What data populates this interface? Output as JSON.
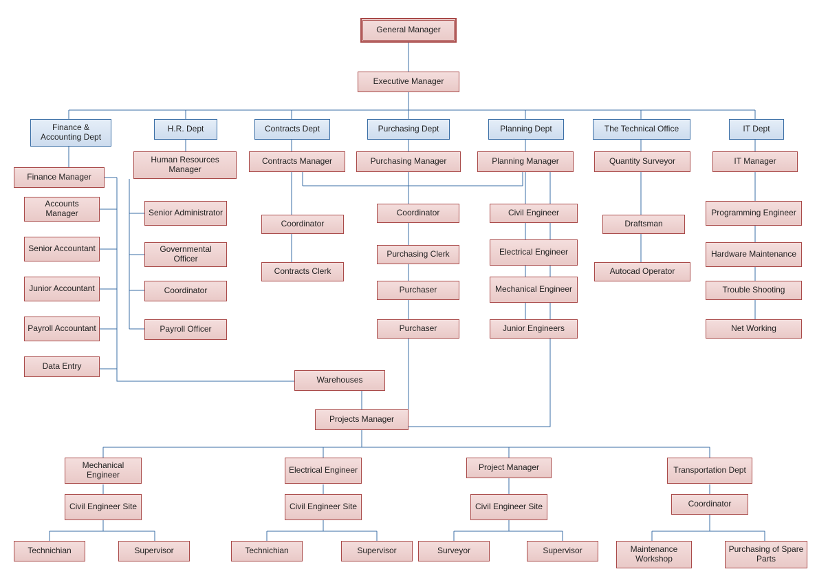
{
  "top": {
    "gm": "General Manager",
    "em": "Executive Manager"
  },
  "depts": {
    "finance": "Finance & Accounting Dept",
    "hr": "H.R. Dept",
    "contracts": "Contracts Dept",
    "purchasing": "Purchasing Dept",
    "planning": "Planning Dept",
    "technical": "The Technical Office",
    "it": "IT Dept"
  },
  "mgr": {
    "finance": "Finance Manager",
    "hr": "Human Resources Manager",
    "contracts": "Contracts Manager",
    "purchasing": "Purchasing Manager",
    "planning": "Planning Manager",
    "technical": "Quantity Surveyor",
    "it": "IT Manager"
  },
  "finance_sub": {
    "accounts_manager": "Accounts Manager",
    "senior_accountant": "Senior Accountant",
    "junior_accountant": "Junior Accountant",
    "payroll_accountant": "Payroll Accountant",
    "data_entry": "Data Entry"
  },
  "hr_sub": {
    "senior_admin": "Senior Administrator",
    "gov_officer": "Governmental Officer",
    "coordinator": "Coordinator",
    "payroll_officer": "Payroll Officer"
  },
  "contracts_sub": {
    "coordinator": "Coordinator",
    "clerk": "Contracts Clerk"
  },
  "purchasing_sub": {
    "coordinator": "Coordinator",
    "clerk": "Purchasing Clerk",
    "purchaser1": "Purchaser",
    "purchaser2": "Purchaser"
  },
  "planning_sub": {
    "civil": "Civil Engineer",
    "electrical": "Electrical Engineer",
    "mechanical": "Mechanical Engineer",
    "junior": "Junior Engineers"
  },
  "technical_sub": {
    "draftsman": "Draftsman",
    "autocad": "Autocad Operator"
  },
  "it_sub": {
    "programming": "Programming Engineer",
    "hardware": "Hardware Maintenance",
    "trouble": "Trouble Shooting",
    "networking": "Net Working"
  },
  "mid": {
    "warehouses": "Warehouses",
    "projects_manager": "Projects Manager"
  },
  "pm_branch": {
    "mech": "Mechanical Engineer",
    "elec": "Electrical Engineer",
    "proj_mgr": "Project Manager",
    "transport": "Transportation Dept",
    "civil_site": "Civil Engineer Site",
    "coordinator": "Coordinator",
    "technichian": "Technichian",
    "supervisor": "Supervisor",
    "surveyor": "Surveyor",
    "maint": "Maintenance Workshop",
    "spare": "Purchasing of Spare Parts"
  }
}
